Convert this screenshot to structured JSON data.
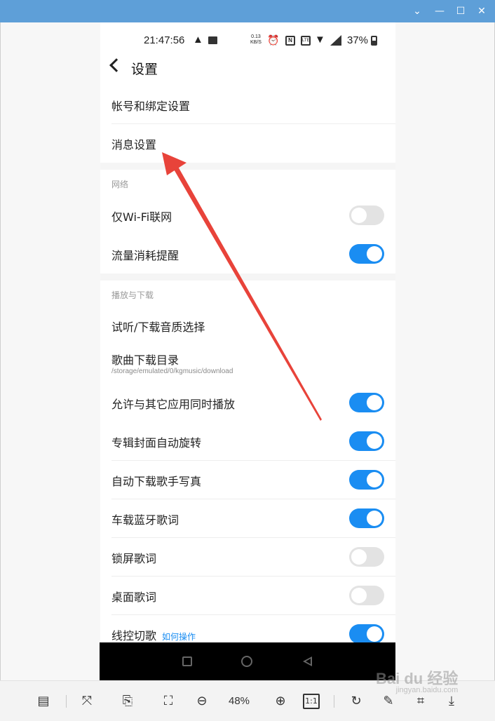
{
  "status_bar": {
    "time": "21:47:56",
    "net_speed_top": "0.13",
    "net_speed_bottom": "KB/S",
    "battery": "37%"
  },
  "header": {
    "title": "设置"
  },
  "account_rows": [
    {
      "label": "帐号和绑定设置"
    },
    {
      "label": "消息设置"
    }
  ],
  "sections": {
    "network_title": "网络",
    "playback_title": "播放与下载"
  },
  "network_rows": [
    {
      "label": "仅Wi-Fi联网",
      "toggle": "off"
    },
    {
      "label": "流量消耗提醒",
      "toggle": "on"
    }
  ],
  "playback_rows": [
    {
      "label": "试听/下载音质选择"
    },
    {
      "label": "歌曲下载目录",
      "sub": "/storage/emulated/0/kgmusic/download"
    },
    {
      "label": "允许与其它应用同时播放",
      "toggle": "on"
    },
    {
      "label": "专辑封面自动旋转",
      "toggle": "on"
    },
    {
      "label": "自动下载歌手写真",
      "toggle": "on"
    },
    {
      "label": "车载蓝牙歌词",
      "toggle": "on"
    },
    {
      "label": "锁屏歌词",
      "toggle": "off"
    },
    {
      "label": "桌面歌词",
      "toggle": "off"
    },
    {
      "label": "线控切歌",
      "link": "如何操作",
      "toggle": "on"
    }
  ],
  "toolbar": {
    "zoom": "48%",
    "one_to_one": "1:1"
  },
  "watermark": {
    "brand": "Bai du 经验",
    "sub": "jingyan.baidu.com"
  },
  "colors": {
    "accent": "#1a8df2",
    "arrow": "#e8433a",
    "titlebar": "#5e9fd8"
  }
}
